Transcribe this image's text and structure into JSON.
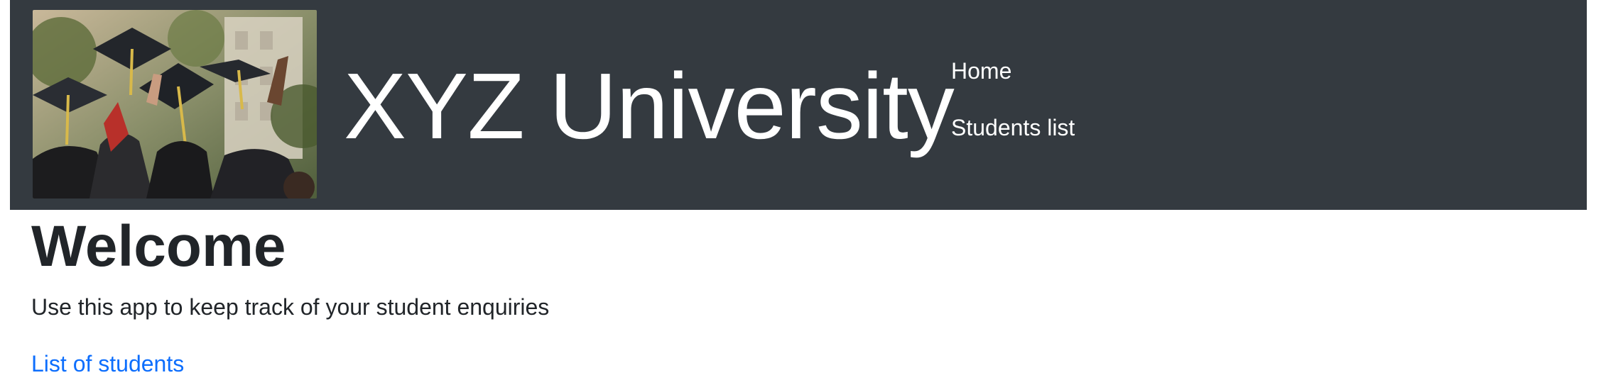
{
  "header": {
    "brand_title": "XYZ University",
    "brand_image_icon": "graduation-caps-photo",
    "nav_links": [
      {
        "label": "Home"
      },
      {
        "label": "Students list"
      }
    ]
  },
  "main": {
    "heading": "Welcome",
    "lead": "Use this app to keep track of your student enquiries",
    "link_label": "List of students"
  },
  "colors": {
    "navbar_background": "#343a40",
    "nav_text": "#ffffff",
    "link": "#0d6efd",
    "body_text": "#212529"
  }
}
